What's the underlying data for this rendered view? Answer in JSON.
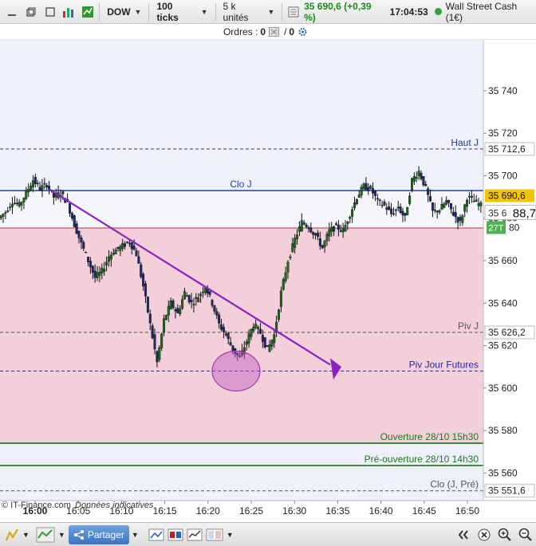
{
  "toolbar": {
    "symbol": "DOW",
    "period": "100 ticks",
    "units": "5 k unités",
    "price_change": "35 690,6 (+0,39 %)",
    "time": "17:04:53",
    "instrument": "Wall Street Cash (1€)"
  },
  "orders": {
    "label": "Ordres :",
    "count_a": "0",
    "count_b": "0"
  },
  "watermark": {
    "source": "© IT-Finance.com",
    "note": "Données indicatives"
  },
  "bottom": {
    "share_label": "Partager"
  },
  "colors": {
    "accent_blue": "#1f3fb4",
    "green_line": "#1a7a1a",
    "pink_zone": "#f2cfd9",
    "price_tag": "#f5c400",
    "candle_up": "#1b6b1b",
    "candle_down": "#1b2a6b",
    "trend_line": "#8a22c2"
  },
  "chart_data": {
    "type": "candlestick",
    "y_ticks": [
      "35 740",
      "35 720",
      "35 700",
      "35 680",
      "35 660",
      "35 640",
      "35 620",
      "35 600",
      "35 580",
      "35 560"
    ],
    "x_ticks": [
      "16:00",
      "16:05",
      "16:10",
      "16:15",
      "16:20",
      "16:25",
      "16:30",
      "16:35",
      "16:40",
      "16:45",
      "16:50"
    ],
    "ylim": [
      35547,
      35764
    ],
    "current_price": {
      "value": "35 690,6",
      "partial": "88,7",
      "secondary": "80",
      "countdown": "27T"
    },
    "levels": [
      {
        "name": "Haut J",
        "value": 35712.6,
        "value_label": "35 712,6",
        "style": "dashed",
        "color": "#223a8a"
      },
      {
        "name": "Clo J",
        "value": 35693,
        "style": "solid",
        "color": "#1f3fb4"
      },
      {
        "name": "Piv J",
        "value": 35626.2,
        "value_label": "35 626,2",
        "style": "dashed",
        "color": "#555555"
      },
      {
        "name": "Piv Jour Futures",
        "value": 35608,
        "style": "dashed",
        "color": "#2a2aa0"
      },
      {
        "name": "Ouverture 28/10 15h30",
        "value": 35574,
        "style": "solid",
        "color": "#1a7a1a"
      },
      {
        "name": "Pré-ouverture 28/10 14h30",
        "value": 35563.5,
        "style": "solid",
        "color": "#1a7a1a"
      },
      {
        "name": "Clo (J, Pré)",
        "value": 35551.6,
        "value_label": "35 551,6",
        "style": "dashed",
        "color": "#555555"
      }
    ],
    "series": [
      {
        "type": "candlestick",
        "closes": [
          35683,
          35688,
          35686,
          35692,
          35698,
          35694,
          35696,
          35690,
          35692,
          35687,
          35677,
          35668,
          35660,
          35652,
          35655,
          35662,
          35665,
          35667,
          35669,
          35663,
          35648,
          35630,
          35612,
          35632,
          35640,
          35635,
          35645,
          35640,
          35643,
          35648,
          35640,
          35630,
          35625,
          35618,
          35614,
          35622,
          35630,
          35626,
          35618,
          35625,
          35645,
          35660,
          35670,
          35678,
          35676,
          35672,
          35666,
          35674,
          35676,
          35674,
          35682,
          35690,
          35695,
          35694,
          35688,
          35686,
          35682,
          35685,
          35680,
          35698,
          35702,
          35694,
          35683,
          35684,
          35688,
          35682,
          35678,
          35690,
          35688,
          35686
        ]
      }
    ]
  }
}
